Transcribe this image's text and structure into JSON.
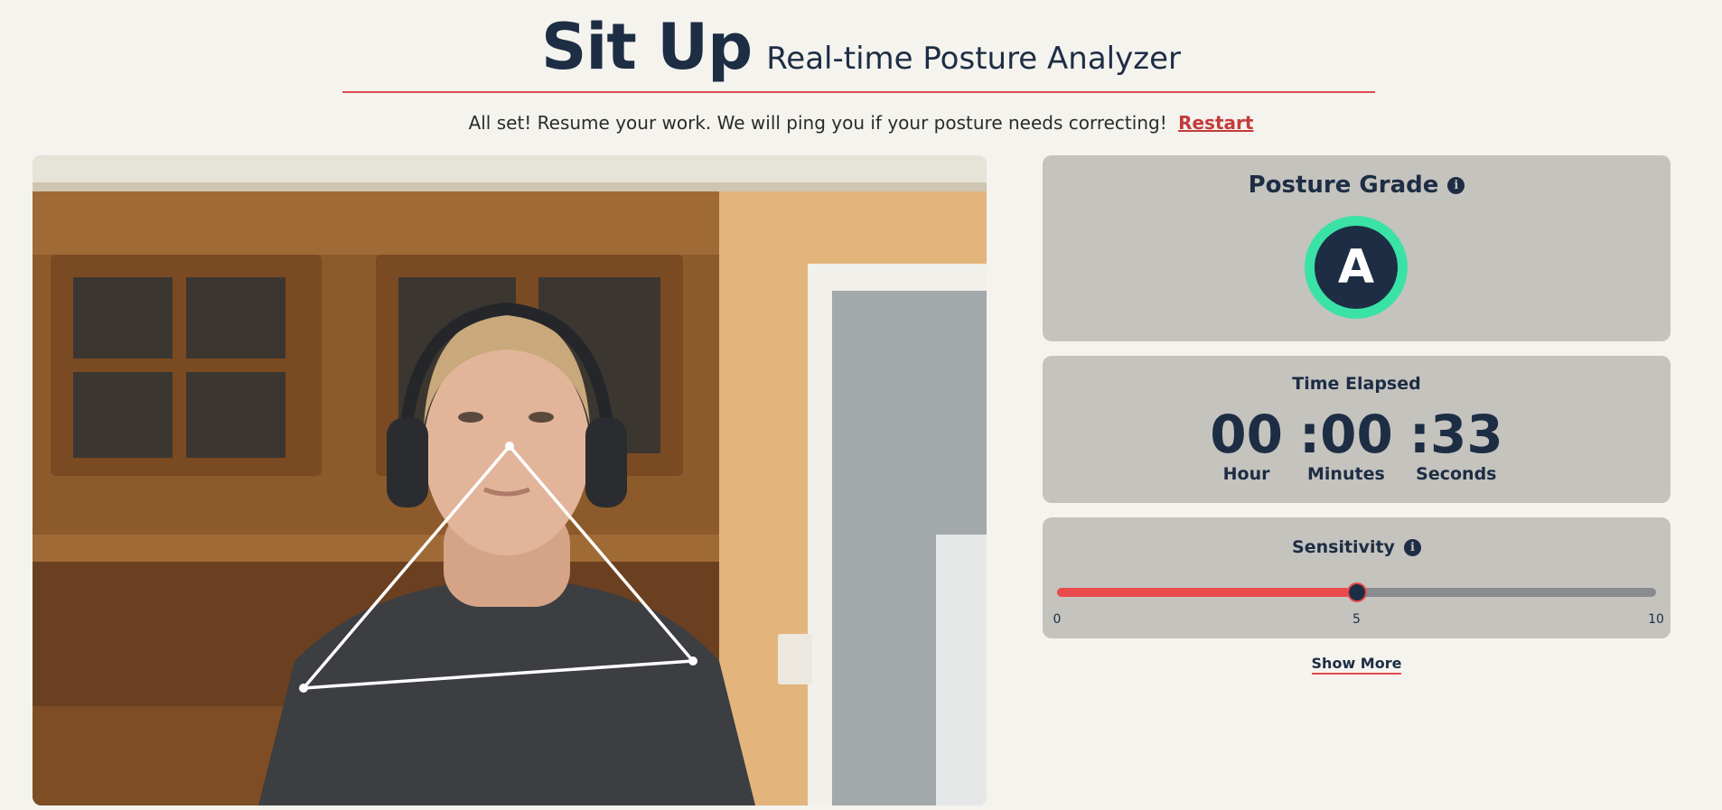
{
  "header": {
    "title": "Sit Up",
    "subtitle": "Real-time Posture Analyzer"
  },
  "status": {
    "message": "All set! Resume your work. We will ping you if your posture needs correcting!",
    "restart_label": "Restart"
  },
  "grade_card": {
    "title": "Posture Grade",
    "info_icon": "info-icon",
    "grade": "A",
    "ring_color": "#3be2a6"
  },
  "time_card": {
    "title": "Time Elapsed",
    "hours": "00",
    "minutes": ":00",
    "seconds": ":33",
    "hours_label": "Hour",
    "minutes_label": "Minutes",
    "seconds_label": "Seconds"
  },
  "sensitivity_card": {
    "title": "Sensitivity",
    "info_icon": "info-icon",
    "min_label": "0",
    "mid_label": "5",
    "max_label": "10",
    "min": 0,
    "max": 10,
    "value": 5,
    "fill_color": "#e94b4b"
  },
  "show_more_label": "Show More",
  "colors": {
    "accent": "#e04a4a",
    "navy": "#1d2d44",
    "card": "#c4c3be"
  }
}
